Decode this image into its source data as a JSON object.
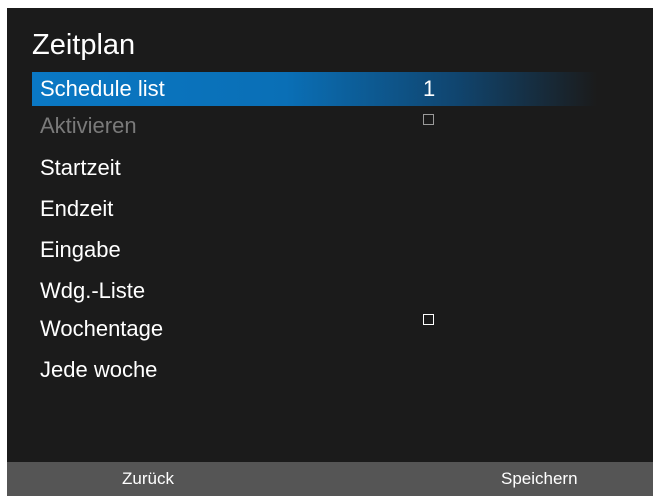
{
  "menu": {
    "title": "Zeitplan",
    "items": [
      {
        "label": "Schedule list",
        "value": "1"
      },
      {
        "label": "Aktivieren",
        "value": ""
      },
      {
        "label": "Startzeit",
        "value": ""
      },
      {
        "label": "Endzeit",
        "value": ""
      },
      {
        "label": "Eingabe",
        "value": ""
      },
      {
        "label": "Wdg.-Liste",
        "value": ""
      },
      {
        "label": "Wochentage",
        "value": ""
      },
      {
        "label": "Jede woche",
        "value": ""
      }
    ]
  },
  "footer": {
    "back_label": "Zurück",
    "save_label": "Speichern"
  },
  "colors": {
    "background": "#1b1b1b",
    "highlight": "#0a78c4",
    "footer": "#555555",
    "disabled_text": "#7a7a7a"
  }
}
